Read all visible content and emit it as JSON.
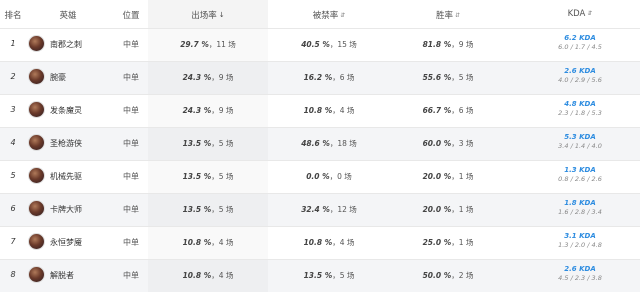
{
  "header": {
    "rank": "排名",
    "hero": "英雄",
    "position": "位置",
    "pick_rate": "出场率",
    "ban_rate": "被禁率",
    "win_rate": "胜率",
    "kda": "KDA"
  },
  "rows": [
    {
      "rank": "1",
      "hero": "南郡之刺",
      "position": "中单",
      "pick_pct": "29.7 %",
      "pick_cnt": "11 场",
      "ban_pct": "40.5 %",
      "ban_cnt": "15 场",
      "win_pct": "81.8 %",
      "win_cnt": "9 场",
      "kda": "6.2 KDA",
      "kda_detail": "6.0 / 1.7 / 4.5"
    },
    {
      "rank": "2",
      "hero": "腕豪",
      "position": "中单",
      "pick_pct": "24.3 %",
      "pick_cnt": "9 场",
      "ban_pct": "16.2 %",
      "ban_cnt": "6 场",
      "win_pct": "55.6 %",
      "win_cnt": "5 场",
      "kda": "2.6 KDA",
      "kda_detail": "4.0 / 2.9 / 5.6"
    },
    {
      "rank": "3",
      "hero": "发条魔灵",
      "position": "中单",
      "pick_pct": "24.3 %",
      "pick_cnt": "9 场",
      "ban_pct": "10.8 %",
      "ban_cnt": "4 场",
      "win_pct": "66.7 %",
      "win_cnt": "6 场",
      "kda": "4.8 KDA",
      "kda_detail": "2.3 / 1.8 / 5.3"
    },
    {
      "rank": "4",
      "hero": "圣枪游侠",
      "position": "中单",
      "pick_pct": "13.5 %",
      "pick_cnt": "5 场",
      "ban_pct": "48.6 %",
      "ban_cnt": "18 场",
      "win_pct": "60.0 %",
      "win_cnt": "3 场",
      "kda": "5.3 KDA",
      "kda_detail": "3.4 / 1.4 / 4.0"
    },
    {
      "rank": "5",
      "hero": "机械先驱",
      "position": "中单",
      "pick_pct": "13.5 %",
      "pick_cnt": "5 场",
      "ban_pct": "0.0 %",
      "ban_cnt": "0 场",
      "win_pct": "20.0 %",
      "win_cnt": "1 场",
      "kda": "1.3 KDA",
      "kda_detail": "0.8 / 2.6 / 2.6"
    },
    {
      "rank": "6",
      "hero": "卡牌大师",
      "position": "中单",
      "pick_pct": "13.5 %",
      "pick_cnt": "5 场",
      "ban_pct": "32.4 %",
      "ban_cnt": "12 场",
      "win_pct": "20.0 %",
      "win_cnt": "1 场",
      "kda": "1.8 KDA",
      "kda_detail": "1.6 / 2.8 / 3.4"
    },
    {
      "rank": "7",
      "hero": "永恒梦魇",
      "position": "中单",
      "pick_pct": "10.8 %",
      "pick_cnt": "4 场",
      "ban_pct": "10.8 %",
      "ban_cnt": "4 场",
      "win_pct": "25.0 %",
      "win_cnt": "1 场",
      "kda": "3.1 KDA",
      "kda_detail": "1.3 / 2.0 / 4.8"
    },
    {
      "rank": "8",
      "hero": "解脱者",
      "position": "中单",
      "pick_pct": "10.8 %",
      "pick_cnt": "4 场",
      "ban_pct": "13.5 %",
      "ban_cnt": "5 场",
      "win_pct": "50.0 %",
      "win_cnt": "2 场",
      "kda": "2.6 KDA",
      "kda_detail": "4.5 / 2.3 / 3.8"
    }
  ]
}
